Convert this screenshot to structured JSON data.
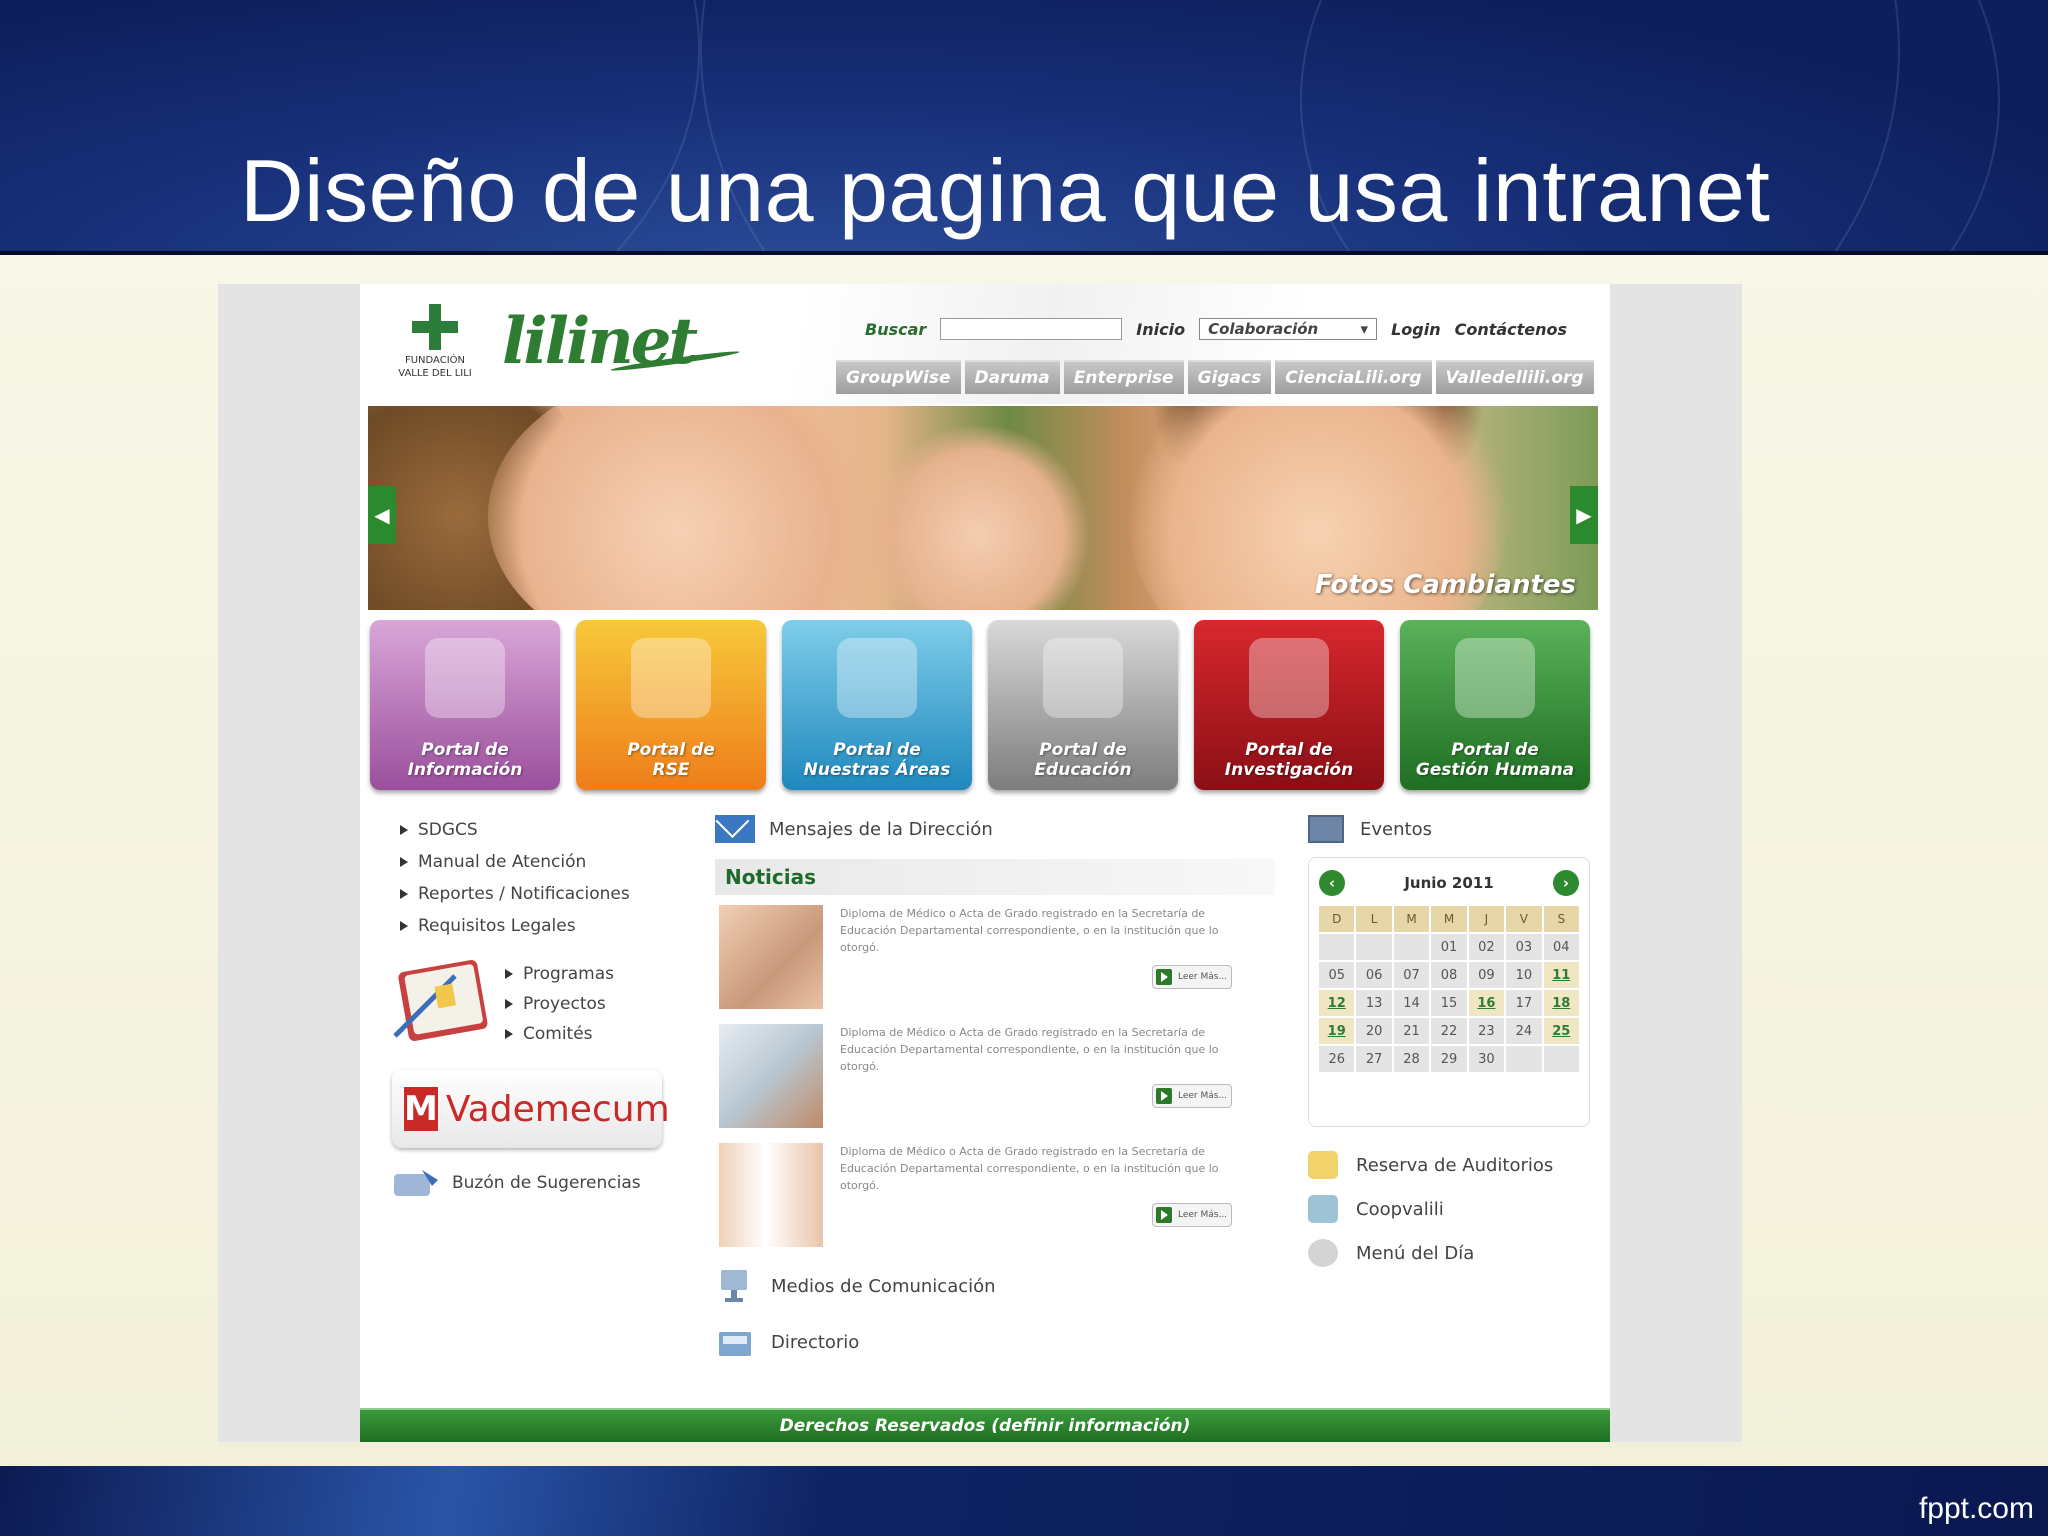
{
  "slide": {
    "title": "Diseño de una pagina que usa intranet",
    "brand": "fppt.com"
  },
  "site": {
    "fvl_logo": "FUNDACIÓN VALLE DEL LILI",
    "logo": "lilinet",
    "search_label": "Buscar",
    "search_placeholder": "",
    "nav": {
      "inicio": "Inicio",
      "colaboracion": "Colaboración",
      "login": "Login",
      "contactenos": "Contáctenos"
    },
    "tabs": [
      "GroupWise",
      "Daruma",
      "Enterprise",
      "Gigacs",
      "CienciaLili.org",
      "Valledellili.org"
    ],
    "banner_caption": "Fotos Cambiantes",
    "portals": [
      {
        "line1": "Portal de",
        "line2": "Información",
        "color": "#b16fb4"
      },
      {
        "line1": "Portal de",
        "line2": "RSE",
        "color": "#f29a1c"
      },
      {
        "line1": "Portal de",
        "line2": "Nuestras Áreas",
        "color": "#2f9ccf"
      },
      {
        "line1": "Portal de",
        "line2": "Educación",
        "color": "#8c8c8c"
      },
      {
        "line1": "Portal de",
        "line2": "Investigación",
        "color": "#b2121b"
      },
      {
        "line1": "Portal de",
        "line2": "Gestión Humana",
        "color": "#2f8c2f"
      }
    ],
    "left_links": [
      "SDGCS",
      "Manual de Atención",
      "Reportes / Notificaciones",
      "Requisitos Legales"
    ],
    "sub_links": [
      "Programas",
      "Proyectos",
      "Comités"
    ],
    "vademecum": "Vademecum",
    "buzon": "Buzón de Sugerencias",
    "mensajes": "Mensajes de la Dirección",
    "noticias_title": "Noticias",
    "news": [
      {
        "text": "Diploma de Médico o Acta de Grado registrado en la Secretaría de Educación Departamental correspondiente, o en la institución que lo otorgó.",
        "button": "Leer Más..."
      },
      {
        "text": "Diploma de Médico o Acta de Grado registrado en la Secretaría de Educación Departamental correspondiente, o en la institución que lo otorgó.",
        "button": "Leer Más..."
      },
      {
        "text": "Diploma de Médico o Acta de Grado registrado en la Secretaría de Educación Departamental correspondiente, o en la institución que lo otorgó.",
        "button": "Leer Más..."
      }
    ],
    "medios": "Medios de Comunicación",
    "directorio": "Directorio",
    "eventos": "Eventos",
    "calendar": {
      "month": "Junio 2011",
      "days_of_week": [
        "D",
        "L",
        "M",
        "M",
        "J",
        "V",
        "S"
      ],
      "cells": [
        "",
        "",
        "",
        "01",
        "02",
        "03",
        "04",
        "05",
        "06",
        "07",
        "08",
        "09",
        "10",
        "11",
        "12",
        "13",
        "14",
        "15",
        "16",
        "17",
        "18",
        "19",
        "20",
        "21",
        "22",
        "23",
        "24",
        "25",
        "26",
        "27",
        "28",
        "29",
        "30",
        "",
        ""
      ],
      "highlighted": [
        "11",
        "12",
        "16",
        "18",
        "19",
        "25"
      ]
    },
    "right_links": [
      "Reserva de Auditorios",
      "Coopvalili",
      "Menú del Día"
    ],
    "footer": "Derechos Reservados  (definir información)"
  }
}
